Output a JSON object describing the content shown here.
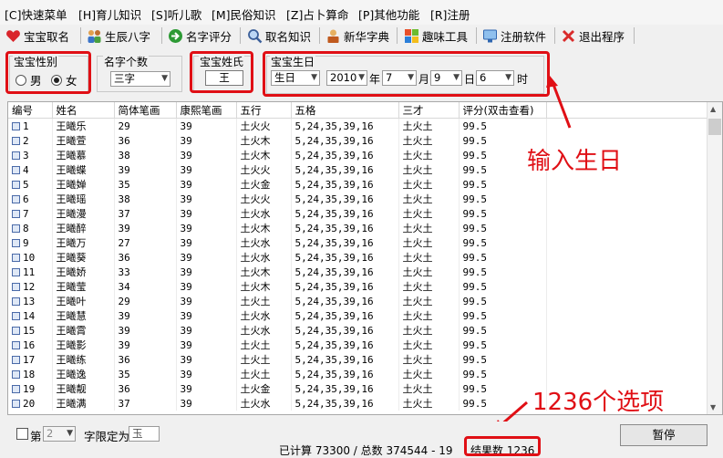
{
  "menu": [
    "[C]快速菜单",
    "[H]育儿知识",
    "[S]听儿歌",
    "[M]民俗知识",
    "[Z]占卜算命",
    "[P]其他功能",
    "[R]注册"
  ],
  "toolbar": [
    {
      "label": "宝宝取名",
      "icon": "heart-icon"
    },
    {
      "label": "生辰八字",
      "icon": "people-icon"
    },
    {
      "label": "名字评分",
      "icon": "arrow-right-icon"
    },
    {
      "label": "取名知识",
      "icon": "magnifier-icon"
    },
    {
      "label": "新华字典",
      "icon": "person-book-icon"
    },
    {
      "label": "趣味工具",
      "icon": "windows-flag-icon"
    },
    {
      "label": "注册软件",
      "icon": "monitor-icon"
    },
    {
      "label": "退出程序",
      "icon": "close-x-icon"
    }
  ],
  "options": {
    "gender_title": "宝宝性别",
    "gender_male": "男",
    "gender_female": "女",
    "gender_selected": "female",
    "count_title": "名字个数",
    "count_value": "三字",
    "surname_title": "宝宝姓氏",
    "surname_value": "王",
    "birth_title": "宝宝生日",
    "birth_type": "生日",
    "year_value": "2010",
    "year_unit": "年",
    "month_value": "7",
    "month_unit": "月",
    "day_value": "9",
    "day_unit": "日",
    "hour_value": "6",
    "hour_unit": "时"
  },
  "table": {
    "headers": [
      "编号",
      "姓名",
      "简体笔画",
      "康熙笔画",
      "五行",
      "五格",
      "三才",
      "评分(双击查看)"
    ],
    "rows": [
      [
        "1",
        "王曦乐",
        "29",
        "39",
        "土火火",
        "5,24,35,39,16",
        "土火土",
        "99.5"
      ],
      [
        "2",
        "王曦萱",
        "36",
        "39",
        "土火木",
        "5,24,35,39,16",
        "土火土",
        "99.5"
      ],
      [
        "3",
        "王曦慕",
        "38",
        "39",
        "土火木",
        "5,24,35,39,16",
        "土火土",
        "99.5"
      ],
      [
        "4",
        "王曦蝶",
        "39",
        "39",
        "土火火",
        "5,24,35,39,16",
        "土火土",
        "99.5"
      ],
      [
        "5",
        "王曦婵",
        "35",
        "39",
        "土火金",
        "5,24,35,39,16",
        "土火土",
        "99.5"
      ],
      [
        "6",
        "王曦瑶",
        "38",
        "39",
        "土火火",
        "5,24,35,39,16",
        "土火土",
        "99.5"
      ],
      [
        "7",
        "王曦漫",
        "37",
        "39",
        "土火水",
        "5,24,35,39,16",
        "土火土",
        "99.5"
      ],
      [
        "8",
        "王曦醉",
        "39",
        "39",
        "土火木",
        "5,24,35,39,16",
        "土火土",
        "99.5"
      ],
      [
        "9",
        "王曦万",
        "27",
        "39",
        "土火水",
        "5,24,35,39,16",
        "土火土",
        "99.5"
      ],
      [
        "10",
        "王曦葵",
        "36",
        "39",
        "土火水",
        "5,24,35,39,16",
        "土火土",
        "99.5"
      ],
      [
        "11",
        "王曦娇",
        "33",
        "39",
        "土火木",
        "5,24,35,39,16",
        "土火土",
        "99.5"
      ],
      [
        "12",
        "王曦莹",
        "34",
        "39",
        "土火木",
        "5,24,35,39,16",
        "土火土",
        "99.5"
      ],
      [
        "13",
        "王曦叶",
        "29",
        "39",
        "土火土",
        "5,24,35,39,16",
        "土火土",
        "99.5"
      ],
      [
        "14",
        "王曦慧",
        "39",
        "39",
        "土火水",
        "5,24,35,39,16",
        "土火土",
        "99.5"
      ],
      [
        "15",
        "王曦霄",
        "39",
        "39",
        "土火水",
        "5,24,35,39,16",
        "土火土",
        "99.5"
      ],
      [
        "16",
        "王曦影",
        "39",
        "39",
        "土火土",
        "5,24,35,39,16",
        "土火土",
        "99.5"
      ],
      [
        "17",
        "王曦练",
        "36",
        "39",
        "土火土",
        "5,24,35,39,16",
        "土火土",
        "99.5"
      ],
      [
        "18",
        "王曦逸",
        "35",
        "39",
        "土火土",
        "5,24,35,39,16",
        "土火土",
        "99.5"
      ],
      [
        "19",
        "王曦靓",
        "36",
        "39",
        "土火金",
        "5,24,35,39,16",
        "土火土",
        "99.5"
      ],
      [
        "20",
        "王曦满",
        "37",
        "39",
        "土火水",
        "5,24,35,39,16",
        "土火土",
        "99.5"
      ]
    ]
  },
  "bottom": {
    "checkbox_label": "第",
    "position_value": "2",
    "fixed_char_label": "字限定为",
    "fixed_char_value": "玉",
    "status_computed": "已计算 73300 / 总数 374544 - 19",
    "result_count": "结果数 1236",
    "pause_button": "暂停"
  },
  "annotations": {
    "birthday_note": "输入生日",
    "results_note": "1236个选项"
  },
  "colors": {
    "annotation_red": "#e00f15"
  }
}
